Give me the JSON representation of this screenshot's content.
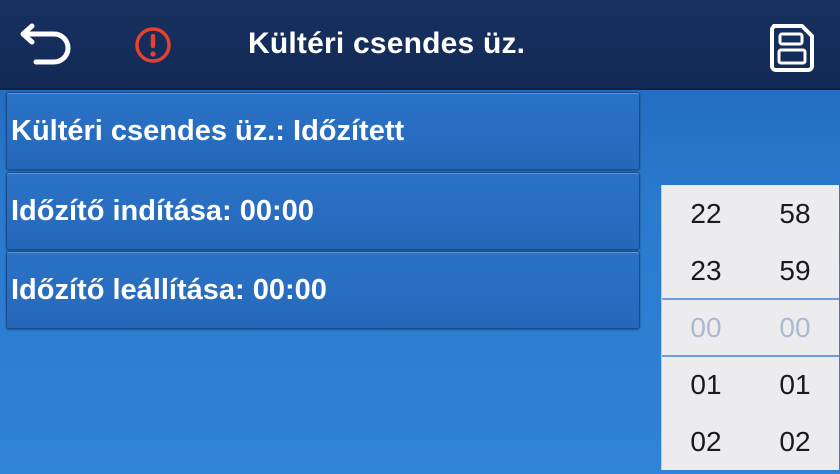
{
  "header": {
    "title": "Kültéri csendes üz.",
    "back_icon": "back-arrow-icon",
    "warning_icon": "warning-icon",
    "save_icon": "save-icon",
    "warning_color": "#e8402f"
  },
  "rows": [
    {
      "label": "Kültéri csendes üz.: Időzített"
    },
    {
      "label": "Időzítő indítása: 00:00"
    },
    {
      "label": "Időzítő leállítása: 00:00"
    }
  ],
  "picker": {
    "hours": [
      "22",
      "23",
      "00",
      "01",
      "02"
    ],
    "minutes": [
      "58",
      "59",
      "00",
      "01",
      "02"
    ],
    "selected_index": 2
  }
}
